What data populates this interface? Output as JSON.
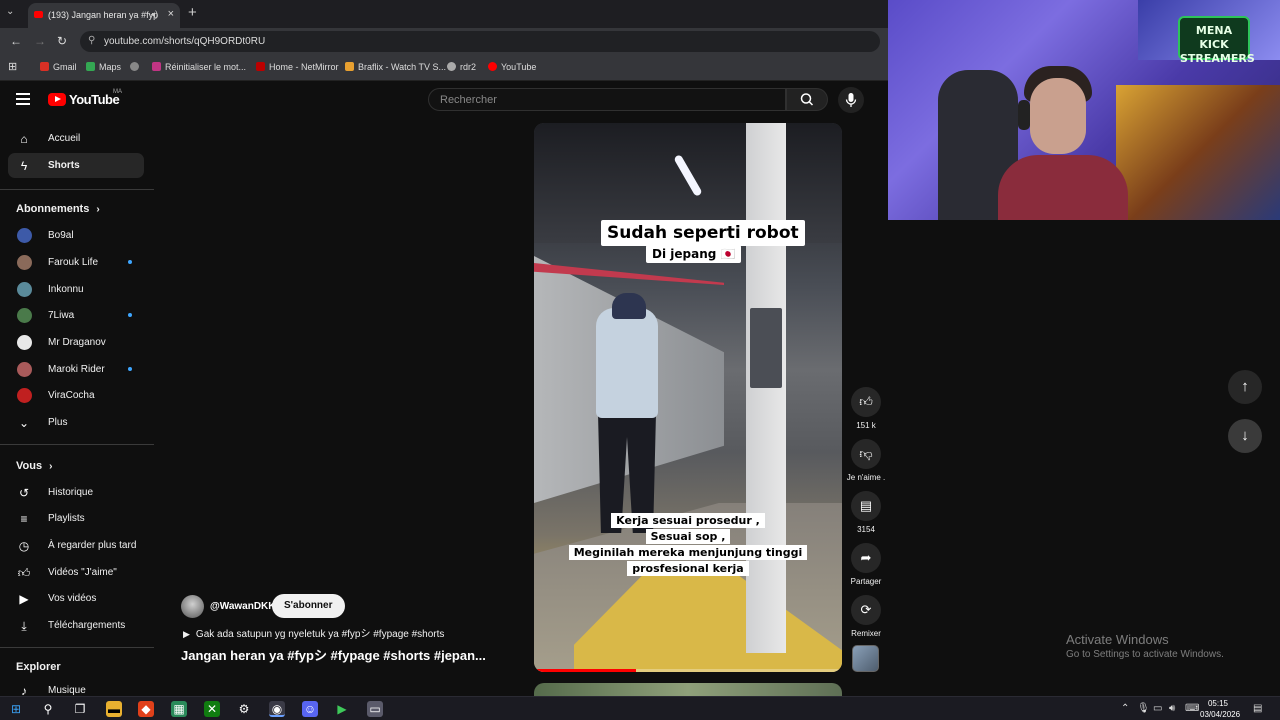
{
  "browser": {
    "tab_title": "(193) Jangan heran ya #fyp",
    "url": "youtube.com/shorts/qQH9ORDt0RU",
    "bookmarks": [
      "Gmail",
      "Maps",
      "Réinitialiser le mot...",
      "Home - NetMirror",
      "Braflix - Watch TV S...",
      "rdr2",
      "YouTube"
    ]
  },
  "header": {
    "logo": "YouTube",
    "country_code": "MA",
    "search_placeholder": "Rechercher"
  },
  "sidebar": {
    "main": [
      {
        "label": "Accueil",
        "icon": "home-icon"
      },
      {
        "label": "Shorts",
        "icon": "shorts-icon"
      }
    ],
    "subscriptions_title": "Abonnements",
    "subscriptions": [
      {
        "label": "Bo9al",
        "live": false,
        "color": "#3d5aa8"
      },
      {
        "label": "Farouk Life",
        "live": true,
        "color": "#8a6a5a"
      },
      {
        "label": "Inkonnu",
        "live": false,
        "color": "#5a8a9a"
      },
      {
        "label": "7Liwa",
        "live": true,
        "color": "#4a7a4a"
      },
      {
        "label": "Mr Draganov",
        "live": false,
        "color": "#e8e8e8"
      },
      {
        "label": "Maroki Rider",
        "live": true,
        "color": "#a85a5a"
      },
      {
        "label": "ViraCocha",
        "live": false,
        "color": "#c02020"
      }
    ],
    "more_label": "Plus",
    "you_title": "Vous",
    "you_items": [
      "Historique",
      "Playlists",
      "À regarder plus tard",
      "Vidéos \"J'aime\"",
      "Vos vidéos",
      "Téléchargements"
    ],
    "explore_title": "Explorer",
    "explore_items": [
      "Musique"
    ]
  },
  "short": {
    "caption_title": "Sudah seperti robot",
    "caption_sub": "Di jepang 🇯🇵",
    "caption_lines": [
      "Kerja sesuai prosedur ,",
      "Sesuai sop ,",
      "Meginilah mereka menjunjung tinggi",
      "prosfesional kerja"
    ],
    "progress": 0.33,
    "channel": "@WawanDKK",
    "subscribe_label": "S'abonner",
    "music": "Gak ada satupun yg nyeletuk ya #fypシ #fypage #shorts",
    "title": "Jangan heran ya #fypシ #fypage #shorts #jepan..."
  },
  "actions": {
    "likes": "151 k",
    "dislike_label": "Je n'aime .",
    "comments": "3154",
    "share_label": "Partager",
    "remix_label": "Remixer"
  },
  "overlay": {
    "badge_line1": "MENA KICK",
    "badge_line2": "STREAMERS",
    "activate_title": "Activate Windows",
    "activate_sub": "Go to Settings to activate Windows."
  },
  "taskbar": {
    "time": "05:15",
    "date": "03/04/2026"
  }
}
